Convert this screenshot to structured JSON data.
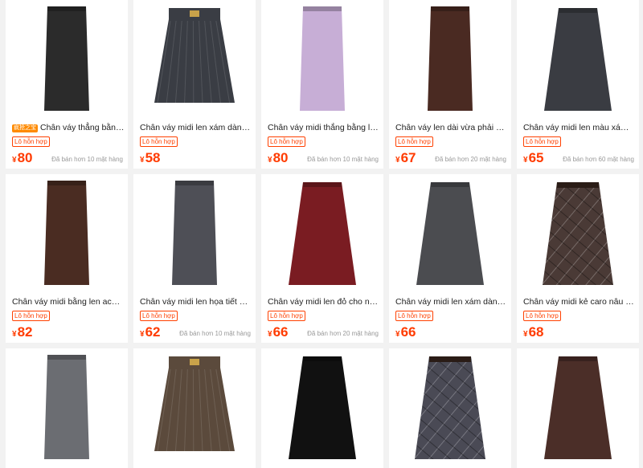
{
  "currency_symbol": "¥",
  "products": [
    {
      "title": "Chân váy thẳng bằng ...",
      "badge": "疯抢之宝",
      "tag": "Lô hỗn hợp",
      "price": "80",
      "sold": "Đã bán hơn 10 mặt hàng",
      "skirt_color": "#2b2b2b",
      "style": "pencil"
    },
    {
      "title": "Chân váy midi len xám dành c...",
      "badge": "",
      "tag": "Lô hỗn hợp",
      "price": "58",
      "sold": "",
      "skirt_color": "#3a3d44",
      "style": "pleated"
    },
    {
      "title": "Chân váy midi thắng bằng len ...",
      "badge": "",
      "tag": "Lô hỗn hợp",
      "price": "80",
      "sold": "Đã bán hơn 10 mặt hàng",
      "skirt_color": "#c7aed6",
      "style": "pencil"
    },
    {
      "title": "Chân váy len dài vừa phải màu...",
      "badge": "",
      "tag": "Lô hỗn hợp",
      "price": "67",
      "sold": "Đã bán hơn 20 mặt hàng",
      "skirt_color": "#4a2a22",
      "style": "pencil"
    },
    {
      "title": "Chân váy midi len màu xám, ki...",
      "badge": "",
      "tag": "Lô hỗn hợp",
      "price": "65",
      "sold": "Đã bán hơn 60 mặt hàng",
      "skirt_color": "#3a3c42",
      "style": "aline"
    },
    {
      "title": "Chân váy midi bằng len acetat...",
      "badge": "",
      "tag": "Lô hỗn hợp",
      "price": "82",
      "sold": "",
      "skirt_color": "#4a2c22",
      "style": "pencil"
    },
    {
      "title": "Chân váy midi len họa tiết da b...",
      "badge": "",
      "tag": "Lô hỗn hợp",
      "price": "62",
      "sold": "Đã bán hơn 10 mặt hàng",
      "skirt_color": "#4e4f56",
      "style": "pencil"
    },
    {
      "title": "Chân váy midi len đỏ cho nữ, k...",
      "badge": "",
      "tag": "Lô hỗn hợp",
      "price": "66",
      "sold": "Đã bán hơn 20 mặt hàng",
      "skirt_color": "#7a1c22",
      "style": "aline"
    },
    {
      "title": "Chân váy midi len xám dành c...",
      "badge": "",
      "tag": "Lô hỗn hợp",
      "price": "66",
      "sold": "",
      "skirt_color": "#4b4c50",
      "style": "aline"
    },
    {
      "title": "Chân váy midi kẻ caro nâu dàn...",
      "badge": "",
      "tag": "Lô hỗn hợp",
      "price": "68",
      "sold": "",
      "skirt_color": "#4a3a36",
      "style": "plaid"
    },
    {
      "title": "",
      "badge": "",
      "tag": "",
      "price": "",
      "sold": "",
      "skirt_color": "#6b6d72",
      "style": "pencil"
    },
    {
      "title": "",
      "badge": "",
      "tag": "",
      "price": "",
      "sold": "",
      "skirt_color": "#5b4a3c",
      "style": "pleated"
    },
    {
      "title": "",
      "badge": "",
      "tag": "",
      "price": "",
      "sold": "",
      "skirt_color": "#111111",
      "style": "aline"
    },
    {
      "title": "",
      "badge": "",
      "tag": "",
      "price": "",
      "sold": "",
      "skirt_color": "#4a4a55",
      "style": "plaid"
    },
    {
      "title": "",
      "badge": "",
      "tag": "",
      "price": "",
      "sold": "",
      "skirt_color": "#4b2e28",
      "style": "aline"
    }
  ]
}
